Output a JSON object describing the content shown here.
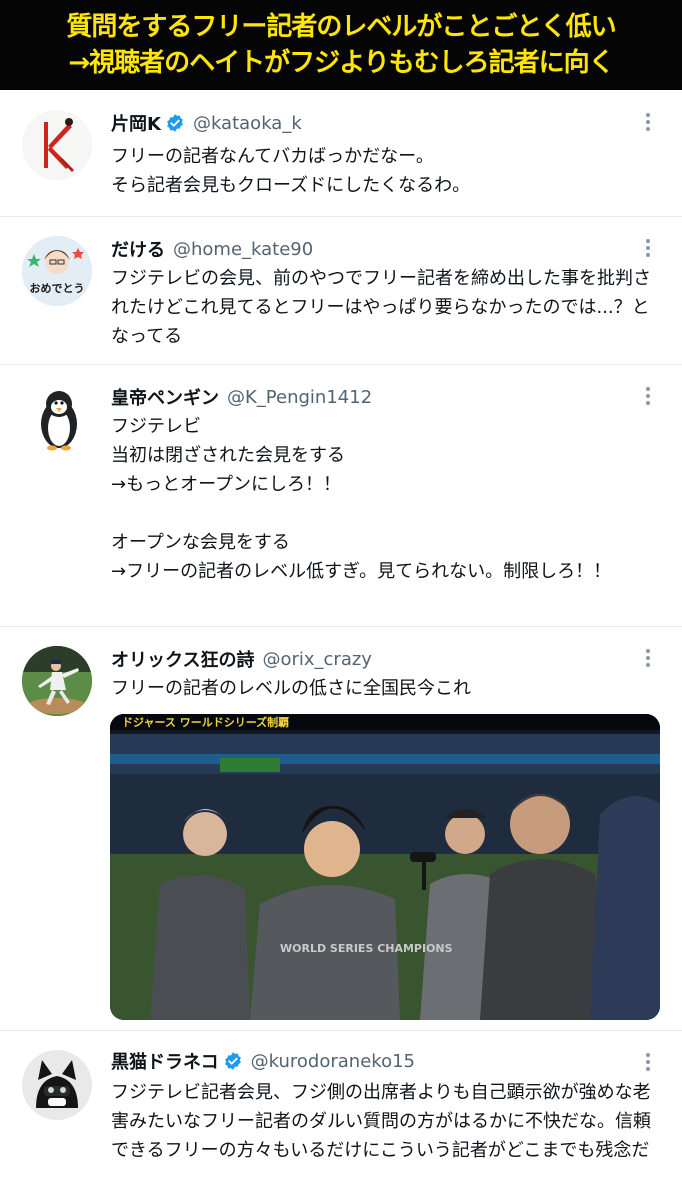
{
  "banner": {
    "line1": "質問をするフリー記者のレベルがことごとく低い",
    "line2": "→視聴者のヘイトがフジよりもむしろ記者に向く"
  },
  "tweets": [
    {
      "display_name": "片岡K",
      "handle": "@kataoka_k",
      "verified": true,
      "text": "フリーの記者なんてバカばっかだなー。\nそら記者会見もクローズドにしたくなるわ。"
    },
    {
      "display_name": "だける",
      "handle": "@home_kate90",
      "verified": false,
      "avatar_text": "おめでとう",
      "text": "フジテレビの会見、前のやつでフリー記者を締め出した事を批判されたけどこれ見てるとフリーはやっぱり要らなかったのでは...？となってる"
    },
    {
      "display_name": "皇帝ペンギン",
      "handle": "@K_Pengin1412",
      "verified": false,
      "text": "フジテレビ\n当初は閉ざされた会見をする\n→もっとオープンにしろ！！\n\nオープンな会見をする\n→フリーの記者のレベル低すぎ。見てられない。制限しろ！！"
    },
    {
      "display_name": "オリックス狂の詩",
      "handle": "@orix_crazy",
      "verified": false,
      "text": "フリーの記者のレベルの低さに全国民今これ",
      "media_caption": "ドジャース ワールドシリーズ制覇",
      "media_shirt_text": "WORLD SERIES CHAMPIONS"
    },
    {
      "display_name": "黒猫ドラネコ",
      "handle": "@kurodoraneko15",
      "verified": true,
      "text": "フジテレビ記者会見、フジ側の出席者よりも自己顕示欲が強めな老害みたいなフリー記者のダルい質問の方がはるかに不快だな。信頼できるフリーの方々もいるだけにこういう記者がどこまでも残念だ"
    }
  ],
  "colors": {
    "banner_bg": "#050505",
    "banner_text": "#ffe600",
    "verified": "#1d9bf0",
    "handle": "#536471"
  }
}
